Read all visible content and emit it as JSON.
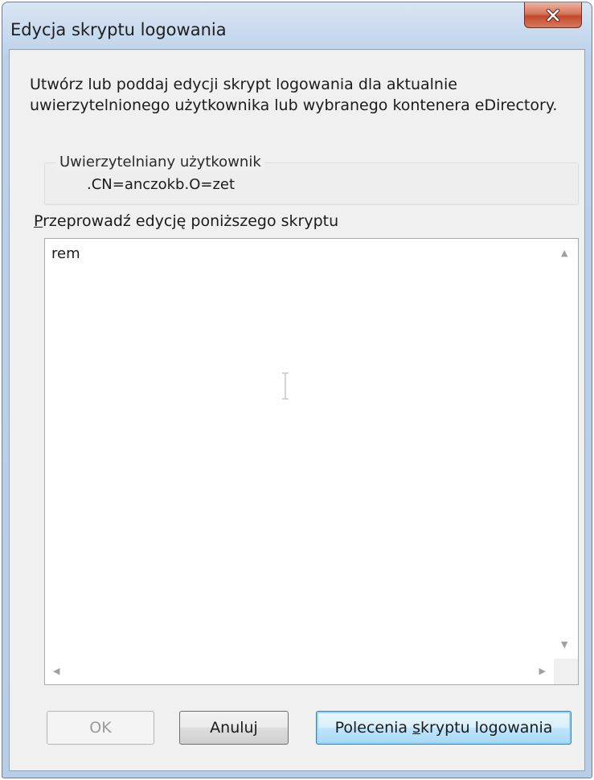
{
  "window": {
    "title": "Edycja skryptu logowania"
  },
  "dialog": {
    "description": "Utwórz lub poddaj edycji skrypt logowania dla aktualnie uwierzytelnionego użytkownika lub wybranego kontenera eDirectory.",
    "authenticated_group": {
      "legend": "Uwierzytelniany użytkownik",
      "value": ".CN=anczokb.O=zet"
    },
    "edit_label_accel": "P",
    "edit_label_rest": "rzeprowadź edycję poniższego skryptu",
    "script_text": "rem"
  },
  "buttons": {
    "ok_label": "OK",
    "cancel_label": "Anuluj",
    "commands_label_pre": "Polecenia ",
    "commands_label_accel": "s",
    "commands_label_post": "kryptu logowania"
  },
  "icons": {
    "close": "close-icon",
    "text_cursor": "i-beam-cursor-icon",
    "scroll_up": "scroll-up-arrow-icon",
    "scroll_down": "scroll-down-arrow-icon",
    "scroll_left": "scroll-left-arrow-icon",
    "scroll_right": "scroll-right-arrow-icon"
  },
  "colors": {
    "window_frame": "#bcd1e8",
    "dialog_background": "#f0f0f0",
    "close_button": "#c14a2c",
    "default_button_border": "#3c7fb1"
  }
}
